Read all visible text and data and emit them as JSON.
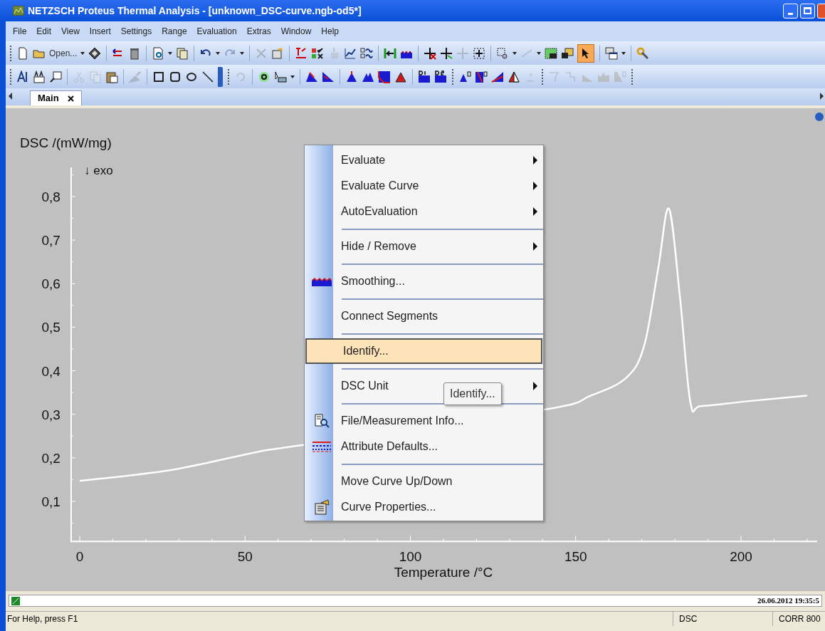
{
  "window": {
    "title": "NETZSCH Proteus Thermal Analysis - [unknown_DSC-curve.ngb-od5*]"
  },
  "menu_bar": [
    {
      "label": "File"
    },
    {
      "label": "Edit"
    },
    {
      "label": "View"
    },
    {
      "label": "Insert"
    },
    {
      "label": "Settings"
    },
    {
      "label": "Range"
    },
    {
      "label": "Evaluation"
    },
    {
      "label": "Extras"
    },
    {
      "label": "Window"
    },
    {
      "label": "Help"
    }
  ],
  "toolbar": {
    "open_label": "Open..."
  },
  "tabs": [
    {
      "label": "Main",
      "selected": true
    }
  ],
  "plot": {
    "chart_data": {
      "type": "line",
      "ylabel": "DSC /(mW/mg)",
      "xlabel": "Temperature /°C",
      "xlim": [
        -2.6,
        223
      ],
      "ylim": [
        0.008,
        0.867
      ],
      "xticks": [
        0,
        50,
        100,
        150,
        200
      ],
      "yticks": [
        {
          "value": 0.1,
          "label": "0,1"
        },
        {
          "value": 0.2,
          "label": "0,2"
        },
        {
          "value": 0.3,
          "label": "0,3"
        },
        {
          "value": 0.4,
          "label": "0,4"
        },
        {
          "value": 0.5,
          "label": "0,5"
        },
        {
          "value": 0.6,
          "label": "0,6"
        },
        {
          "value": 0.7,
          "label": "0,7"
        },
        {
          "value": 0.8,
          "label": "0,8"
        }
      ],
      "annotations": [
        "↓ exo"
      ],
      "x": [
        0,
        27.6,
        53.4,
        66,
        140,
        154.6,
        165.3,
        170.7,
        175,
        178.2,
        181.5,
        184.7,
        188,
        202,
        220
      ],
      "series": [
        {
          "color": "#ffffff",
          "values": [
            0.147,
            0.172,
            0.213,
            0.228,
            0.31,
            0.343,
            0.384,
            0.457,
            0.637,
            0.772,
            0.572,
            0.327,
            0.319,
            0.33,
            0.343
          ]
        }
      ]
    }
  },
  "context_menu": [
    {
      "kind": "item",
      "label": "Evaluate",
      "submenu": true,
      "selected": false
    },
    {
      "kind": "item",
      "label": "Evaluate Curve",
      "submenu": true,
      "selected": false
    },
    {
      "kind": "item",
      "label": "AutoEvaluation",
      "submenu": true,
      "selected": false
    },
    {
      "kind": "separator"
    },
    {
      "kind": "item",
      "label": "Hide / Remove",
      "submenu": true,
      "selected": false
    },
    {
      "kind": "separator"
    },
    {
      "kind": "item",
      "label": "Smoothing...",
      "submenu": false,
      "selected": false
    },
    {
      "kind": "separator"
    },
    {
      "kind": "item",
      "label": "Connect Segments",
      "submenu": false,
      "selected": false
    },
    {
      "kind": "separator"
    },
    {
      "kind": "item",
      "label": "Identify...",
      "submenu": false,
      "selected": true
    },
    {
      "kind": "separator"
    },
    {
      "kind": "item",
      "label": "DSC Unit",
      "submenu": true,
      "selected": false
    },
    {
      "kind": "separator"
    },
    {
      "kind": "item",
      "label": "File/Measurement Info...",
      "submenu": false,
      "selected": false
    },
    {
      "kind": "item",
      "label": "Attribute Defaults...",
      "submenu": false,
      "selected": false
    },
    {
      "kind": "separator"
    },
    {
      "kind": "item",
      "label": "Move Curve Up/Down",
      "submenu": false,
      "selected": false
    },
    {
      "kind": "item",
      "label": "Curve Properties...",
      "submenu": false,
      "selected": false
    }
  ],
  "tooltip": "Identify...",
  "info_bar": {
    "timestamp": "26.06.2012 19:35:5"
  },
  "status_bar": {
    "help": "For Help, press F1",
    "panes": [
      "DSC",
      "CORR 800"
    ]
  }
}
